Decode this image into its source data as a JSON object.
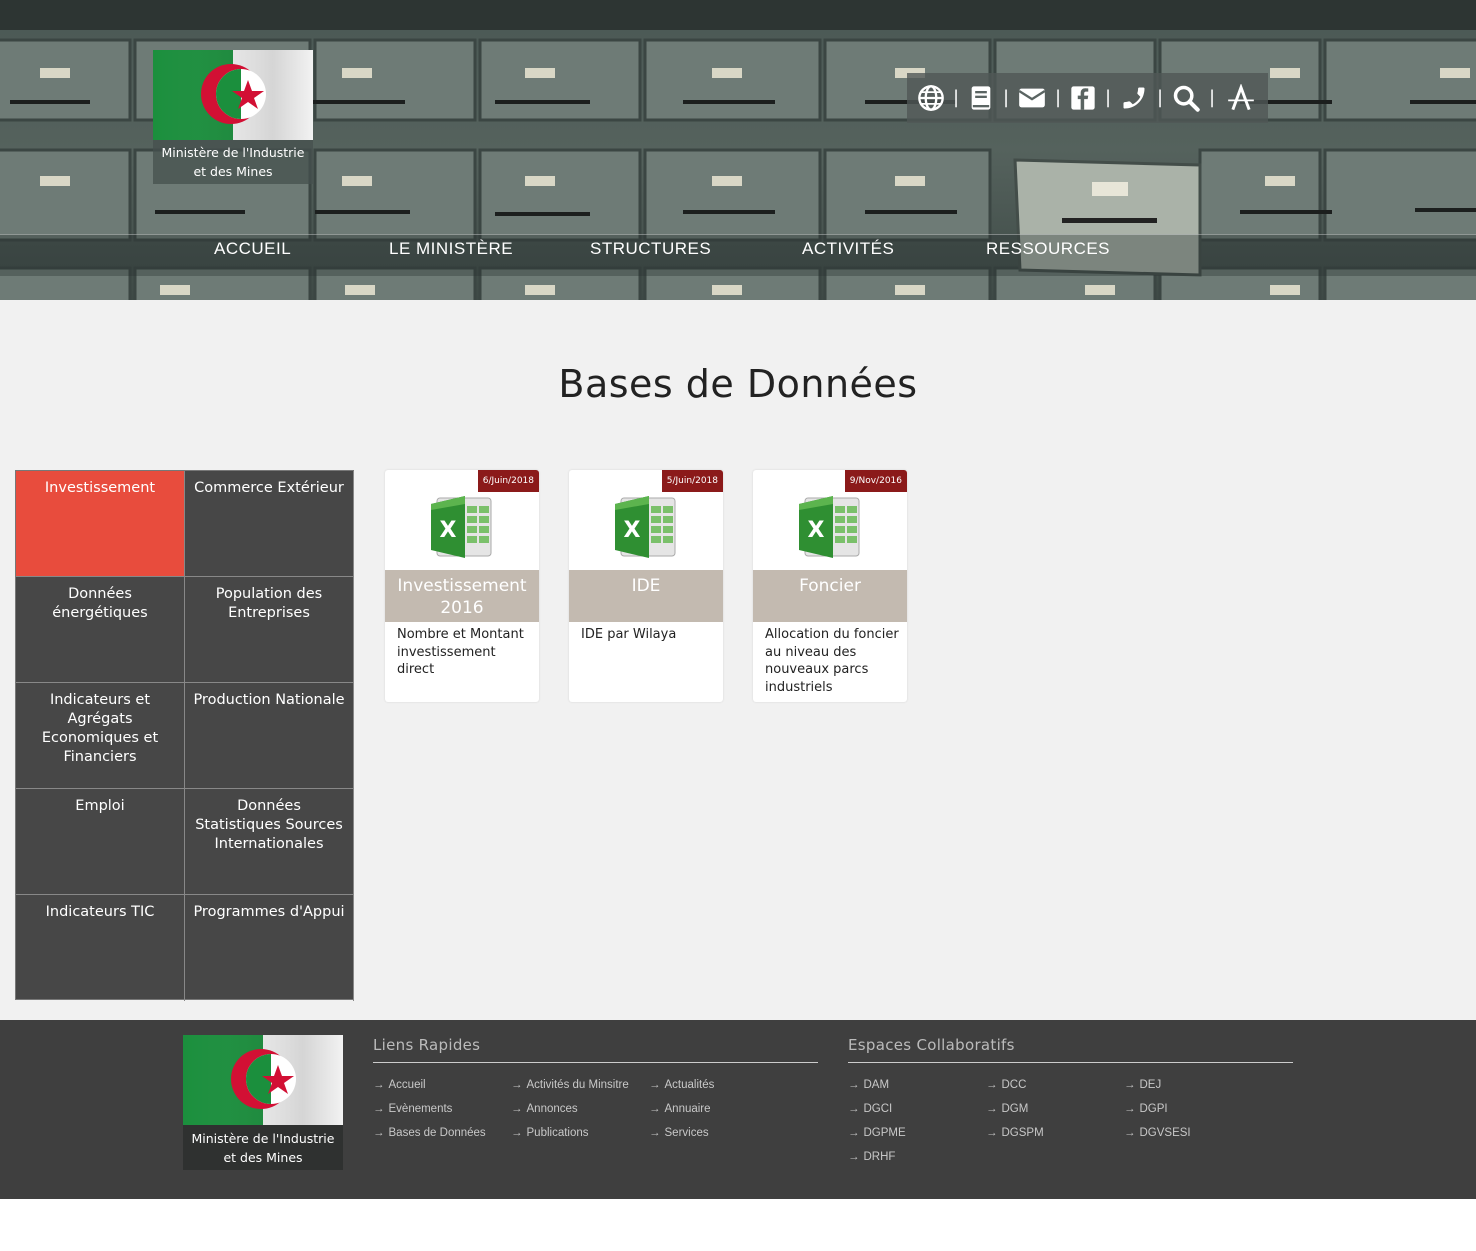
{
  "header": {
    "logo_text_line1": "Ministère de l'Industrie",
    "logo_text_line2": "et des Mines",
    "tools": [
      "globe-icon",
      "book-icon",
      "envelope-icon",
      "facebook-icon",
      "phone-icon",
      "search-icon",
      "font-size-icon"
    ],
    "separator": "|",
    "nav": [
      "ACCUEIL",
      "LE MINISTÈRE",
      "STRUCTURES",
      "ACTIVITÉS",
      "RESSOURCES"
    ]
  },
  "main": {
    "title": "Bases de Données",
    "categories": [
      "Investissement",
      "Commerce Extérieur",
      "Données énergétiques",
      "Population des Entreprises",
      "Indicateurs et Agrégats Economiques et Financiers",
      "Production Nationale",
      "Emploi",
      "Données Statistiques Sources Internationales",
      "Indicateurs TIC",
      "Programmes d'Appui"
    ],
    "active_category": "Investissement",
    "active_color": "#e84c3d",
    "cards": [
      {
        "date": "6/Juin/2018",
        "title": "Investissement 2016",
        "desc": "Nombre et Montant investissement direct"
      },
      {
        "date": "5/Juin/2018",
        "title": "IDE",
        "desc": "IDE par Wilaya"
      },
      {
        "date": "9/Nov/2016",
        "title": "Foncier",
        "desc": "Allocation du foncier au niveau des nouveaux parcs industriels"
      }
    ]
  },
  "footer": {
    "logo_text_line1": "Ministère de l'Industrie",
    "logo_text_line2": "et des Mines",
    "quick_links_title": "Liens Rapides",
    "quick_links": [
      "Accueil",
      "Activités du Minsitre",
      "Actualités",
      "Evènements",
      "Annonces",
      "Annuaire",
      "Bases de Données",
      "Publications",
      "Services"
    ],
    "collab_title": "Espaces Collaboratifs",
    "collab_links": [
      "DAM",
      "DCC",
      "DEJ",
      "DGCI",
      "DGM",
      "DGPI",
      "DGPME",
      "DGSPM",
      "DGVSESI",
      "DRHF"
    ]
  }
}
